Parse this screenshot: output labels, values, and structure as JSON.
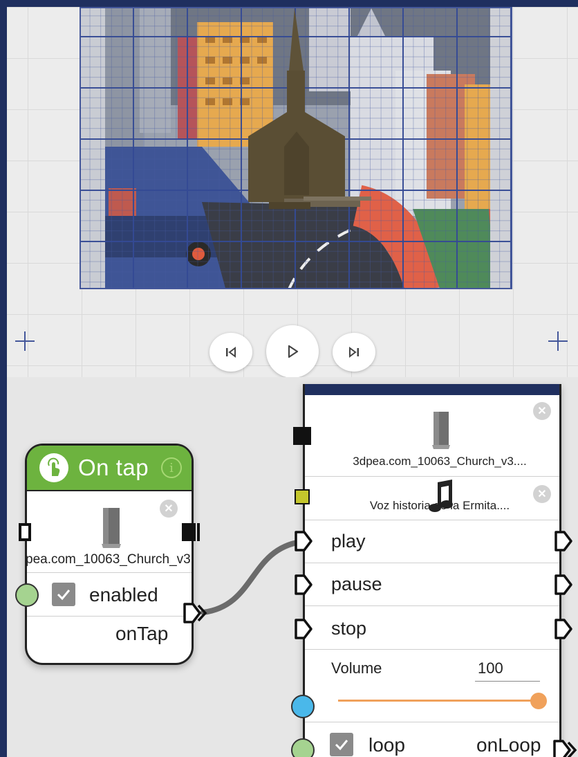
{
  "playback": {
    "prev_icon": "skip-back-icon",
    "play_icon": "play-icon",
    "next_icon": "skip-forward-icon"
  },
  "ontap_node": {
    "title": "On tap",
    "icon": "tap-hand-icon",
    "object_name": "pea.com_10063_Church_v3",
    "enabled_label": "enabled",
    "enabled_checked": true,
    "output_label": "onTap",
    "header_color": "#6db33f"
  },
  "sound_node": {
    "model_name": "3dpea.com_10063_Church_v3....",
    "audio_name": "Voz historia de la Ermita....",
    "audio_icon": "music-note-icon",
    "actions": [
      "play",
      "pause",
      "stop"
    ],
    "volume_label": "Volume",
    "volume_value": "100",
    "volume_level": 1.0,
    "loop_label": "loop",
    "loop_checked": true,
    "loop_output": "onLoop",
    "accent_color": "#f0a15b"
  },
  "colors": {
    "frame": "#1f2f5f",
    "grid_line": "#44579a",
    "port_bool": "#a5d390",
    "port_number": "#4ab8ea",
    "port_audio": "#c4c62c"
  }
}
